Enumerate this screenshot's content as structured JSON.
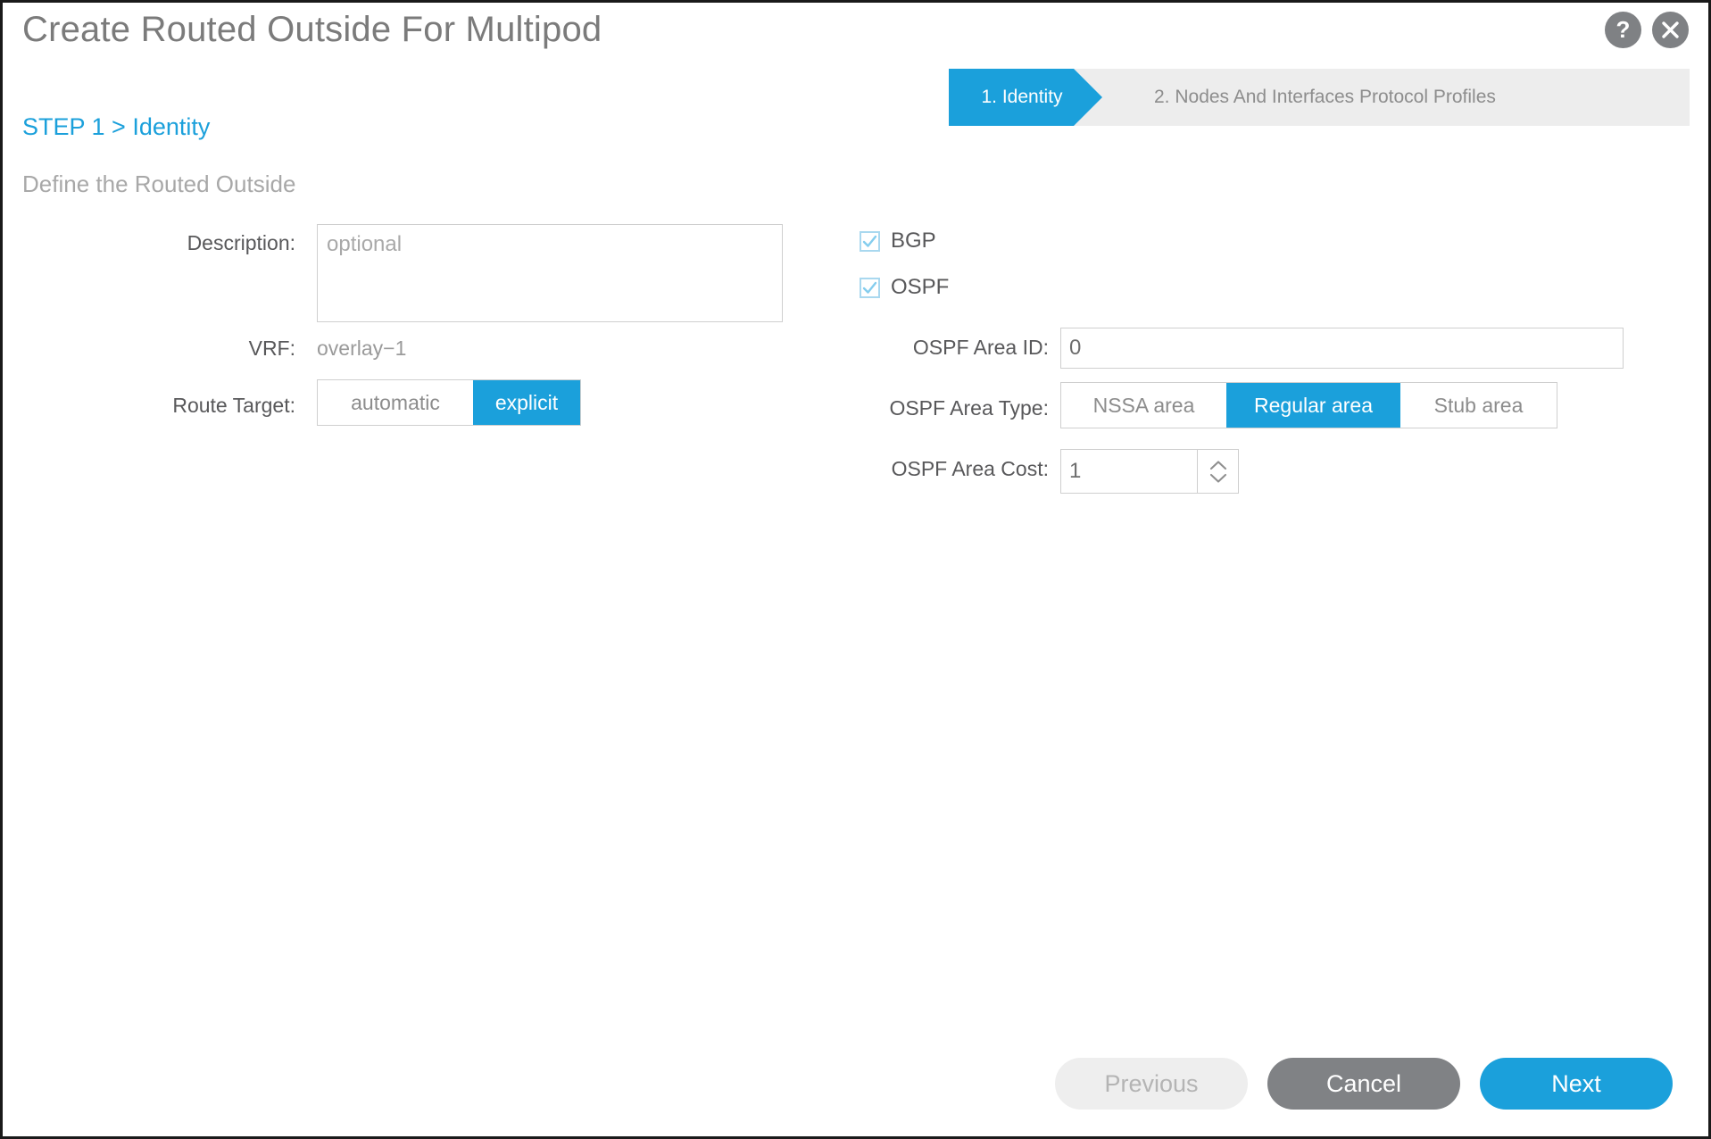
{
  "dialog": {
    "title": "Create Routed Outside For Multipod",
    "help_icon": "question-mark-icon",
    "close_icon": "close-icon"
  },
  "steps": [
    {
      "label": "1. Identity",
      "state": "active"
    },
    {
      "label": "2. Nodes And Interfaces Protocol Profiles",
      "state": "inactive"
    }
  ],
  "headings": {
    "step": "STEP 1 > Identity",
    "subtitle": "Define the Routed Outside"
  },
  "left_form": {
    "description": {
      "label": "Description:",
      "value": "",
      "placeholder": "optional"
    },
    "vrf": {
      "label": "VRF:",
      "value": "overlay−1"
    },
    "route_target": {
      "label": "Route Target:",
      "options": [
        "automatic",
        "explicit"
      ],
      "selected": "explicit"
    }
  },
  "right_form": {
    "protocols": [
      {
        "label": "BGP",
        "checked": true
      },
      {
        "label": "OSPF",
        "checked": true
      }
    ],
    "ospf_area_id": {
      "label": "OSPF Area ID:",
      "value": "0"
    },
    "ospf_area_type": {
      "label": "OSPF Area Type:",
      "options": [
        "NSSA area",
        "Regular area",
        "Stub area"
      ],
      "selected": "Regular area"
    },
    "ospf_area_cost": {
      "label": "OSPF Area Cost:",
      "value": "1",
      "stepper_up_icon": "chevron-up-icon",
      "stepper_down_icon": "chevron-down-icon"
    }
  },
  "footer": {
    "previous": "Previous",
    "cancel": "Cancel",
    "next": "Next"
  },
  "colors": {
    "accent_blue": "#1ba0db",
    "step_inactive_bg": "#ededed",
    "label_gray": "#58585a",
    "muted_gray": "#a8a8a8",
    "cancel_gray": "#808285",
    "checkbox_blue": "#a9d8ef"
  }
}
